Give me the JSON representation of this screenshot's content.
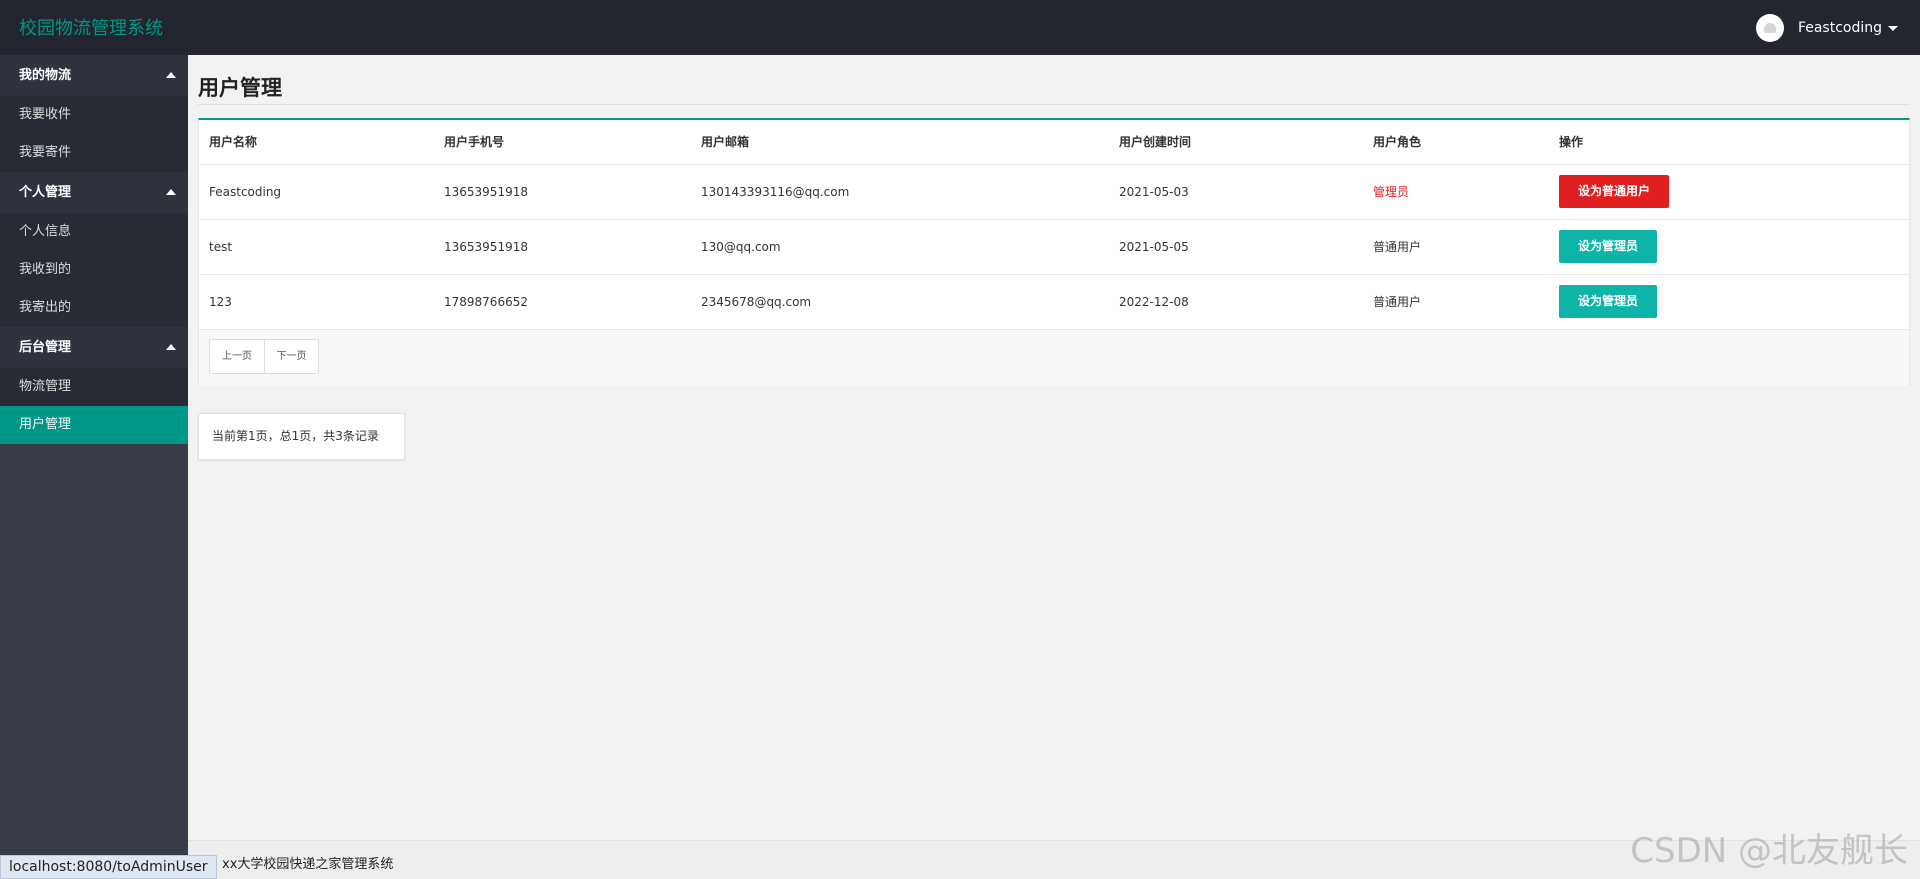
{
  "header": {
    "app_title": "校园物流管理系统",
    "username": "Feastcoding"
  },
  "sidebar": {
    "groups": [
      {
        "title": "我的物流",
        "items": [
          {
            "label": "我要收件"
          },
          {
            "label": "我要寄件"
          }
        ]
      },
      {
        "title": "个人管理",
        "items": [
          {
            "label": "个人信息"
          },
          {
            "label": "我收到的"
          },
          {
            "label": "我寄出的"
          }
        ]
      },
      {
        "title": "后台管理",
        "items": [
          {
            "label": "物流管理"
          },
          {
            "label": "用户管理",
            "active": true
          }
        ]
      }
    ]
  },
  "main": {
    "page_title": "用户管理",
    "table": {
      "columns": [
        "用户名称",
        "用户手机号",
        "用户邮箱",
        "用户创建时间",
        "用户角色",
        "操作"
      ],
      "rows": [
        {
          "name": "Feastcoding",
          "phone": "13653951918",
          "email": "130143393116@qq.com",
          "created": "2021-05-03",
          "role": "管理员",
          "action": "设为普通用户"
        },
        {
          "name": "test",
          "phone": "13653951918",
          "email": "130@qq.com",
          "created": "2021-05-05",
          "role": "普通用户",
          "action": "设为管理员"
        },
        {
          "name": "123",
          "phone": "17898766652",
          "email": "2345678@qq.com",
          "created": "2022-12-08",
          "role": "普通用户",
          "action": "设为管理员"
        }
      ]
    },
    "pager": {
      "prev_label": "上一页",
      "next_label": "下一页"
    },
    "page_info": "当前第1页，总1页，共3条记录"
  },
  "footer": {
    "text": "xx大学校园快递之家管理系统"
  },
  "status_bar": {
    "url": "localhost:8080/toAdminUser"
  },
  "watermark": "CSDN @北友舰长",
  "colors": {
    "accent": "#009688",
    "danger": "#e02020",
    "header_bg": "#23262e",
    "sidebar_bg": "#393d49"
  }
}
